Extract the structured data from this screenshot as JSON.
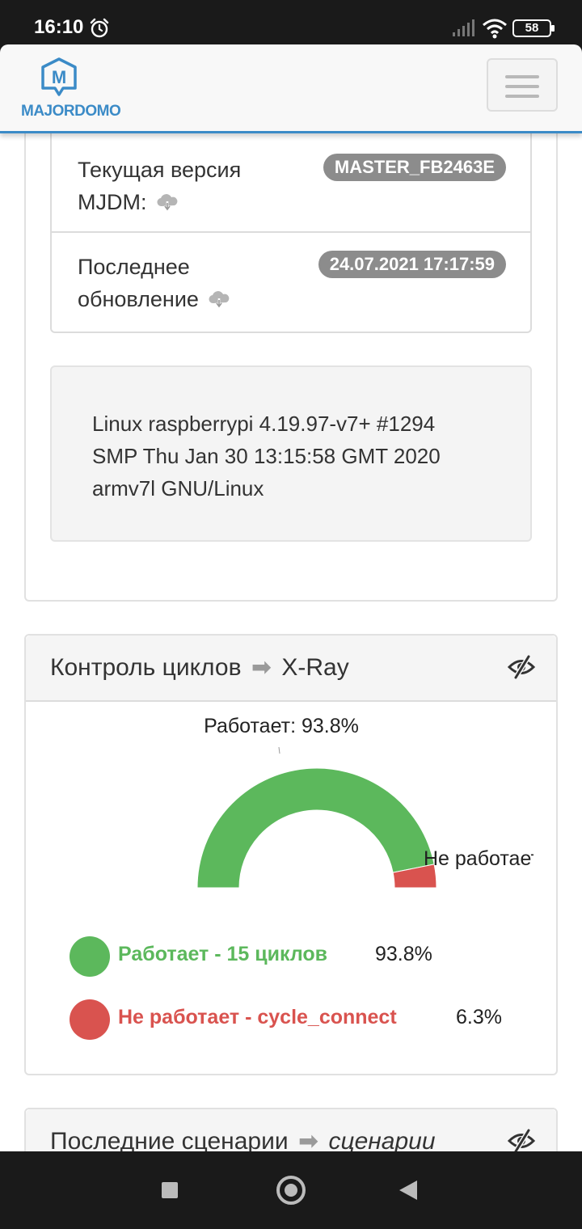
{
  "status_bar": {
    "time": "16:10",
    "battery": "58",
    "icons": [
      "alarm-icon",
      "signal-icon",
      "wifi-icon",
      "battery-icon"
    ]
  },
  "navbar": {
    "logo_letter": "M",
    "logo_text": "MAJORDOMO",
    "menu_icon": "hamburger-icon",
    "brand_color": "#3b8bc7"
  },
  "system_info": {
    "rows": [
      {
        "label_line1": "Текущая версия",
        "label_line2": "MJDM:",
        "value": "MASTER_FB2463E",
        "icon": "cloud-download-icon"
      },
      {
        "label_line1": "Последнее",
        "label_line2": "обновление",
        "value": "24.07.2021 17:17:59",
        "icon": "cloud-download-icon"
      }
    ],
    "kernel": {
      "line1": "Linux raspberrypi 4.19.97-v7+ #1294",
      "line2": "SMP Thu Jan 30 13:15:58 GMT 2020",
      "line3": "armv7l GNU/Linux"
    }
  },
  "cycles_panel": {
    "title": "Контроль циклов",
    "arrow": "➡",
    "link": "X-Ray",
    "eye_icon": "eye-slash-icon",
    "legend": [
      {
        "label": "Работает - 15 циклов",
        "value": "93.8%",
        "color": "#5cb85c"
      },
      {
        "label": "Не работает - cycle_connect",
        "value": "6.3%",
        "color": "#d9534f"
      }
    ]
  },
  "chart_data": {
    "type": "pie",
    "subtype": "semi-donut",
    "categories": [
      "Работает",
      "Не работает"
    ],
    "values": [
      93.8,
      6.3
    ],
    "colors": [
      "#5cb85c",
      "#d9534f"
    ],
    "labels": [
      "Работает: 93.8%",
      "Не работает"
    ]
  },
  "scenarios_panel": {
    "title": "Последние сценарии",
    "arrow": "➡",
    "link": "сценарии",
    "eye_icon": "eye-slash-icon"
  },
  "system_nav": {
    "icons": [
      "recents-icon",
      "home-icon",
      "back-icon"
    ]
  }
}
